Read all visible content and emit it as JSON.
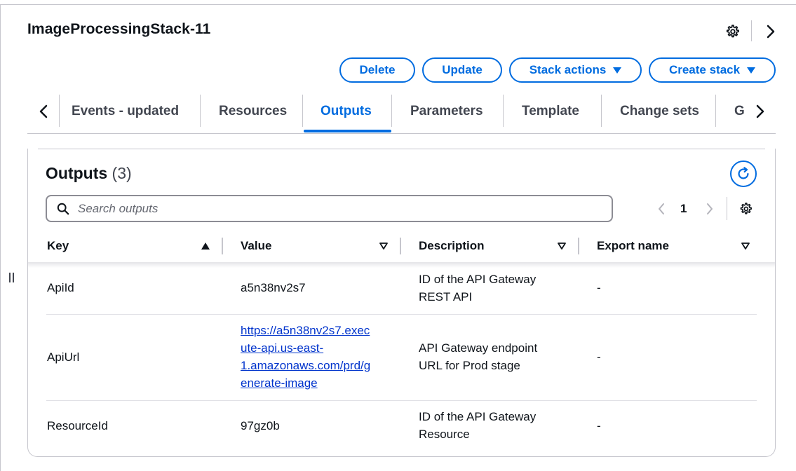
{
  "header": {
    "title": "ImageProcessingStack-11",
    "actions": {
      "delete": "Delete",
      "update": "Update",
      "stack_actions": "Stack actions",
      "create_stack": "Create stack"
    }
  },
  "tabs": [
    {
      "label": "Events - updated"
    },
    {
      "label": "Resources"
    },
    {
      "label": "Outputs",
      "active": true
    },
    {
      "label": "Parameters"
    },
    {
      "label": "Template"
    },
    {
      "label": "Change sets"
    },
    {
      "label": "G"
    }
  ],
  "outputs": {
    "title": "Outputs",
    "count": "(3)",
    "search_placeholder": "Search outputs",
    "page": "1",
    "columns": {
      "key": "Key",
      "value": "Value",
      "description": "Description",
      "export_name": "Export name"
    },
    "rows": [
      {
        "key": "ApiId",
        "value": "a5n38nv2s7",
        "description": [
          "ID of the API Gateway",
          "REST API"
        ],
        "export": "-"
      },
      {
        "key": "ApiUrl",
        "value_lines": [
          "https://a5n38nv2s7.exec",
          "ute-api.us-east-",
          "1.amazonaws.com/prd/g",
          "enerate-image"
        ],
        "description": [
          "API Gateway endpoint",
          "URL for Prod stage"
        ],
        "export": "-"
      },
      {
        "key": "ResourceId",
        "value": "97gz0b",
        "description": [
          "ID of the API Gateway",
          "Resource"
        ],
        "export": "-"
      }
    ]
  },
  "colors": {
    "accent": "#006ce0",
    "link": "#0033cc",
    "text": "#0f141a",
    "border": "#c6c6cd"
  },
  "icons": [
    "gear-icon",
    "chevron-right-icon",
    "chevron-left-icon",
    "caret-down-icon",
    "refresh-icon",
    "search-icon",
    "sort-ascending-icon",
    "sort-descending-icon",
    "drag-handle-icon"
  ]
}
